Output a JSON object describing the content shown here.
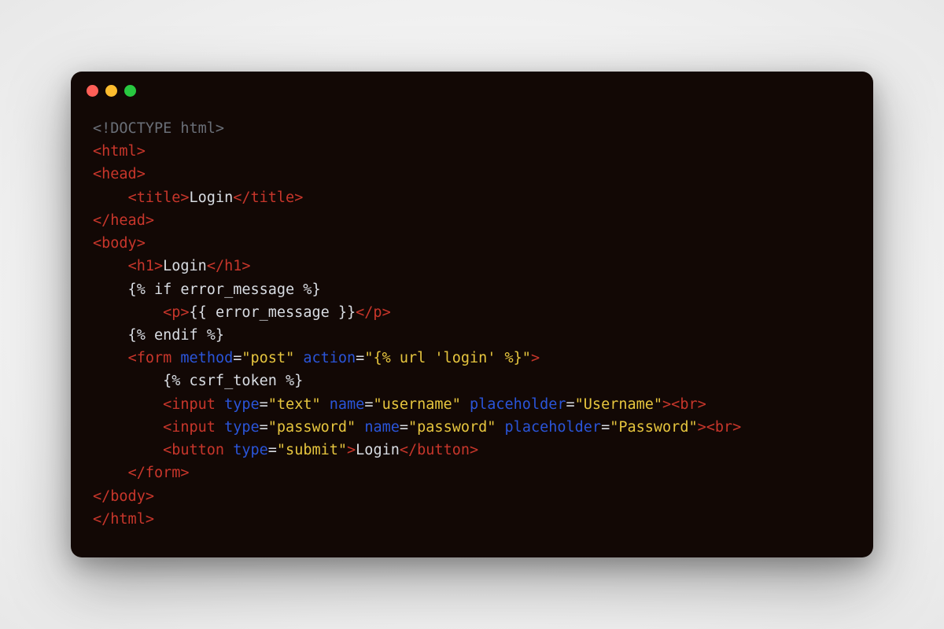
{
  "window": {
    "dot_red": "#ff5f57",
    "dot_yellow": "#febc2e",
    "dot_green": "#28c840"
  },
  "colors": {
    "doctype": "#6a6f78",
    "tag": "#c8362b",
    "attr": "#2a55d9",
    "string": "#e6c53e",
    "text": "#d9dde3",
    "bg": "#120805"
  },
  "code": {
    "tokens": [
      [
        [
          "doctype",
          "<!DOCTYPE html>"
        ]
      ],
      [
        [
          "tag",
          "<html>"
        ]
      ],
      [
        [
          "tag",
          "<head>"
        ]
      ],
      [
        [
          "txt",
          "    "
        ],
        [
          "tag",
          "<title>"
        ],
        [
          "txt",
          "Login"
        ],
        [
          "tag",
          "</title>"
        ]
      ],
      [
        [
          "tag",
          "</head>"
        ]
      ],
      [
        [
          "tag",
          "<body>"
        ]
      ],
      [
        [
          "txt",
          "    "
        ],
        [
          "tag",
          "<h1>"
        ],
        [
          "txt",
          "Login"
        ],
        [
          "tag",
          "</h1>"
        ]
      ],
      [
        [
          "txt",
          "    {% if error_message %}"
        ]
      ],
      [
        [
          "txt",
          "        "
        ],
        [
          "tag",
          "<p>"
        ],
        [
          "txt",
          "{{ error_message }}"
        ],
        [
          "tag",
          "</p>"
        ]
      ],
      [
        [
          "txt",
          "    {% endif %}"
        ]
      ],
      [
        [
          "txt",
          "    "
        ],
        [
          "tag",
          "<form"
        ],
        [
          "txt",
          " "
        ],
        [
          "attr",
          "method"
        ],
        [
          "txt",
          "="
        ],
        [
          "str",
          "\"post\""
        ],
        [
          "txt",
          " "
        ],
        [
          "attr",
          "action"
        ],
        [
          "txt",
          "="
        ],
        [
          "str",
          "\"{% url 'login' %}\""
        ],
        [
          "tag",
          ">"
        ]
      ],
      [
        [
          "txt",
          "        {% csrf_token %}"
        ]
      ],
      [
        [
          "txt",
          "        "
        ],
        [
          "tag",
          "<input"
        ],
        [
          "txt",
          " "
        ],
        [
          "attr",
          "type"
        ],
        [
          "txt",
          "="
        ],
        [
          "str",
          "\"text\""
        ],
        [
          "txt",
          " "
        ],
        [
          "attr",
          "name"
        ],
        [
          "txt",
          "="
        ],
        [
          "str",
          "\"username\""
        ],
        [
          "txt",
          " "
        ],
        [
          "attr",
          "placeholder"
        ],
        [
          "txt",
          "="
        ],
        [
          "str",
          "\"Username\""
        ],
        [
          "tag",
          "><br>"
        ]
      ],
      [
        [
          "txt",
          "        "
        ],
        [
          "tag",
          "<input"
        ],
        [
          "txt",
          " "
        ],
        [
          "attr",
          "type"
        ],
        [
          "txt",
          "="
        ],
        [
          "str",
          "\"password\""
        ],
        [
          "txt",
          " "
        ],
        [
          "attr",
          "name"
        ],
        [
          "txt",
          "="
        ],
        [
          "str",
          "\"password\""
        ],
        [
          "txt",
          " "
        ],
        [
          "attr",
          "placeholder"
        ],
        [
          "txt",
          "="
        ],
        [
          "str",
          "\"Password\""
        ],
        [
          "tag",
          "><br>"
        ]
      ],
      [
        [
          "txt",
          "        "
        ],
        [
          "tag",
          "<button"
        ],
        [
          "txt",
          " "
        ],
        [
          "attr",
          "type"
        ],
        [
          "txt",
          "="
        ],
        [
          "str",
          "\"submit\""
        ],
        [
          "tag",
          ">"
        ],
        [
          "txt",
          "Login"
        ],
        [
          "tag",
          "</button>"
        ]
      ],
      [
        [
          "txt",
          "    "
        ],
        [
          "tag",
          "</form>"
        ]
      ],
      [
        [
          "tag",
          "</body>"
        ]
      ],
      [
        [
          "tag",
          "</html>"
        ]
      ]
    ]
  }
}
